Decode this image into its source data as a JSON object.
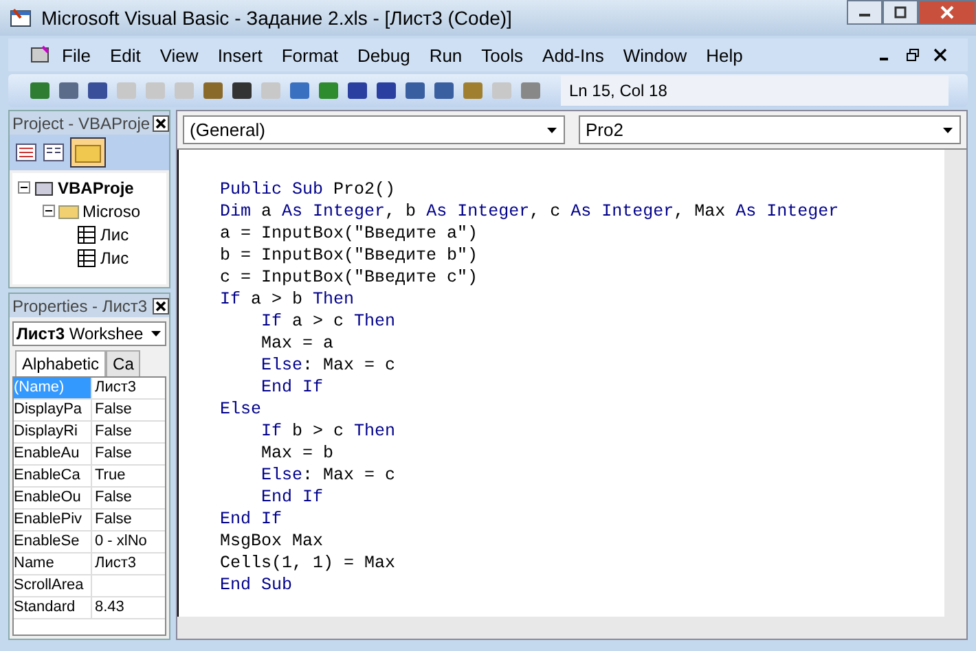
{
  "window": {
    "title": "Microsoft Visual Basic - Задание 2.xls - [Лист3 (Code)]"
  },
  "menu": [
    "File",
    "Edit",
    "View",
    "Insert",
    "Format",
    "Debug",
    "Run",
    "Tools",
    "Add-Ins",
    "Window",
    "Help"
  ],
  "toolbar": {
    "buttons": [
      {
        "disabled": false
      },
      {
        "disabled": false
      },
      {
        "disabled": false
      },
      {
        "disabled": true
      },
      {
        "disabled": true
      },
      {
        "disabled": true
      },
      {
        "disabled": false
      },
      {
        "disabled": false
      },
      {
        "disabled": true
      },
      {
        "disabled": false
      },
      {
        "disabled": false
      },
      {
        "disabled": false
      },
      {
        "disabled": false
      },
      {
        "disabled": false
      },
      {
        "disabled": false
      },
      {
        "disabled": false
      },
      {
        "disabled": true
      },
      {
        "disabled": false
      }
    ],
    "position": "Ln 15, Col 18"
  },
  "project": {
    "title": "Project - VBAProje",
    "tree": [
      {
        "label": "VBAProje",
        "expanded": true,
        "children": [
          {
            "label": "Microso",
            "expanded": true,
            "children": [
              {
                "label": "Лис"
              },
              {
                "label": "Лис"
              }
            ]
          }
        ]
      }
    ]
  },
  "properties": {
    "title": "Properties - Лист3",
    "object": {
      "name": "Лист3",
      "type": "Workshee"
    },
    "tabs": [
      {
        "label": "Alphabetic",
        "selected": true
      },
      {
        "label": "Ca",
        "selected": false
      }
    ],
    "rows": [
      {
        "name": "(Name)",
        "value": "Лист3",
        "selected": true
      },
      {
        "name": "DisplayPa",
        "value": "False",
        "selected": false
      },
      {
        "name": "DisplayRi",
        "value": "False",
        "selected": false
      },
      {
        "name": "EnableAu",
        "value": "False",
        "selected": false
      },
      {
        "name": "EnableCa",
        "value": "True",
        "selected": false
      },
      {
        "name": "EnableOu",
        "value": "False",
        "selected": false
      },
      {
        "name": "EnablePiv",
        "value": "False",
        "selected": false
      },
      {
        "name": "EnableSe",
        "value": "0 - xlNo",
        "selected": false
      },
      {
        "name": "Name",
        "value": "Лист3",
        "selected": false
      },
      {
        "name": "ScrollArea",
        "selected": false
      },
      {
        "name": "Standard",
        "value": "8.43",
        "selected": false
      }
    ]
  },
  "code": {
    "object": "(General)",
    "procedure": "Pro2",
    "lines": [
      {
        "indent": false,
        "segments": [
          {
            "text": "Public Sub",
            "kind": "keyword"
          },
          {
            "text": " Pro2()",
            "kind": "plain"
          }
        ]
      },
      {
        "indent": false,
        "segments": [
          {
            "text": "Dim",
            "kind": "keyword"
          },
          {
            "text": " a ",
            "kind": "plain"
          },
          {
            "text": "As Integer",
            "kind": "keyword"
          },
          {
            "text": ", b ",
            "kind": "plain"
          },
          {
            "text": "As Integer",
            "kind": "keyword"
          },
          {
            "text": ", c ",
            "kind": "plain"
          },
          {
            "text": "As Integer",
            "kind": "keyword"
          },
          {
            "text": ", Max ",
            "kind": "plain"
          },
          {
            "text": "As Integer",
            "kind": "keyword"
          }
        ]
      },
      {
        "indent": false,
        "segments": [
          {
            "text": "a = InputBox(\"Введите a\")",
            "kind": "plain"
          }
        ]
      },
      {
        "indent": false,
        "segments": [
          {
            "text": "b = InputBox(\"Введите b\")",
            "kind": "plain"
          }
        ]
      },
      {
        "indent": false,
        "segments": [
          {
            "text": "c = InputBox(\"Введите c\")",
            "kind": "plain"
          }
        ]
      },
      {
        "indent": false,
        "segments": [
          {
            "text": "If",
            "kind": "keyword"
          },
          {
            "text": " a > b ",
            "kind": "plain"
          },
          {
            "text": "Then",
            "kind": "keyword"
          }
        ]
      },
      {
        "indent": true,
        "segments": [
          {
            "text": "If",
            "kind": "keyword"
          },
          {
            "text": " a > c ",
            "kind": "plain"
          },
          {
            "text": "Then",
            "kind": "keyword"
          }
        ]
      },
      {
        "indent": true,
        "segments": [
          {
            "text": "Max = a",
            "kind": "plain"
          }
        ]
      },
      {
        "indent": true,
        "segments": [
          {
            "text": "Else",
            "kind": "keyword"
          },
          {
            "text": ": Max = c",
            "kind": "plain"
          }
        ]
      },
      {
        "indent": true,
        "segments": [
          {
            "text": "End If",
            "kind": "keyword"
          }
        ]
      },
      {
        "indent": false,
        "segments": [
          {
            "text": "Else",
            "kind": "keyword"
          }
        ]
      },
      {
        "indent": true,
        "segments": [
          {
            "text": "If",
            "kind": "keyword"
          },
          {
            "text": " b > c ",
            "kind": "plain"
          },
          {
            "text": "Then",
            "kind": "keyword"
          }
        ]
      },
      {
        "indent": true,
        "segments": [
          {
            "text": "Max = b",
            "kind": "plain"
          }
        ]
      },
      {
        "indent": true,
        "segments": [
          {
            "text": "Else",
            "kind": "keyword"
          },
          {
            "text": ": Max = c",
            "kind": "plain"
          }
        ]
      },
      {
        "indent": true,
        "segments": [
          {
            "text": "End If",
            "kind": "keyword"
          }
        ]
      },
      {
        "indent": false,
        "segments": [
          {
            "text": "End If",
            "kind": "keyword"
          }
        ]
      },
      {
        "indent": false,
        "segments": [
          {
            "text": "MsgBox Max",
            "kind": "plain"
          }
        ]
      },
      {
        "indent": false,
        "segments": [
          {
            "text": "Cells(1, 1) = Max",
            "kind": "plain"
          }
        ]
      },
      {
        "indent": false,
        "segments": [
          {
            "text": "End Sub",
            "kind": "keyword"
          }
        ]
      }
    ]
  }
}
